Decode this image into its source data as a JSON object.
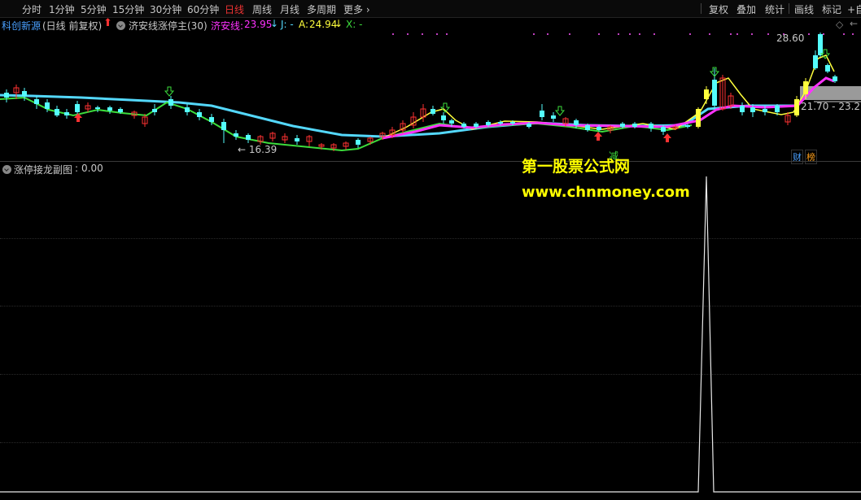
{
  "toolbar": {
    "periods": [
      "分时",
      "1分钟",
      "5分钟",
      "15分钟",
      "30分钟",
      "60分钟",
      "日线",
      "周线",
      "月线",
      "多周期",
      "更多"
    ],
    "active_period": "日线",
    "right_tools": [
      "复权",
      "叠加",
      "统计",
      "画线",
      "标记",
      "+自"
    ]
  },
  "main_chart": {
    "stock_name": "科创新源",
    "mode": "(日线 前复权)",
    "indicator_name": "济安线涨停主(30)",
    "jian_label": "济安线:",
    "jian_value": "23.95",
    "j_label": "J: -",
    "a_label": "A:",
    "a_value": "24.94",
    "x_label": "X: -",
    "high_label": "28.60",
    "low_label": "16.39",
    "range_label": "21.70 - 23.21",
    "jian_char": "减",
    "cai_char": "财",
    "bang_char": "榜"
  },
  "sub_chart": {
    "title": "涨停接龙副图",
    "value": "0.00"
  },
  "watermark": {
    "line1": "第一股票公式网",
    "line2": "www.chnmoney.com"
  },
  "colors": {
    "up": "#ff3232",
    "down": "#54fcfc",
    "cyan_line": "#54d8fc",
    "green_line": "#3cdc3c",
    "yellow_line": "#ffff3c",
    "magenta_line": "#ff32ff",
    "watermark": "#ffff00"
  }
}
